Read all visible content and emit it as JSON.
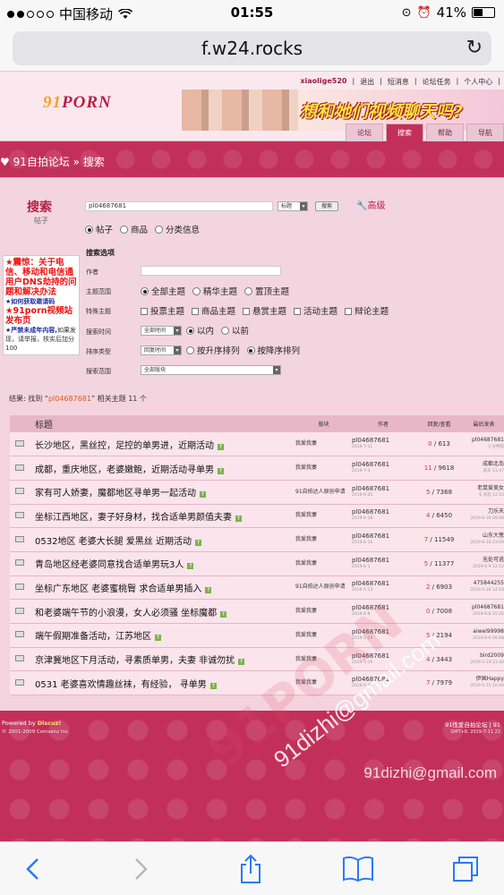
{
  "status_bar": {
    "carrier": "中国移动",
    "time": "01:55",
    "battery": "41%",
    "battery_level": 0.41
  },
  "browser": {
    "url": "f.w24.rocks"
  },
  "site": {
    "top_links": [
      "xiaolige520",
      "退出",
      "短消息",
      "论坛任务",
      "个人中心"
    ],
    "logo_main": "91",
    "logo_accent": "PORN",
    "banner_text": "想和她们视频聊天吗?",
    "nav_tabs": [
      "论坛",
      "搜索",
      "帮助",
      "导航"
    ],
    "breadcrumb": "91自拍论坛 » 搜索"
  },
  "search": {
    "title": "搜索",
    "subtitle": "帖子",
    "keyword": "pl04687681",
    "field_select": "标题",
    "search_button": "搜索",
    "advanced": "高级",
    "types": [
      "帖子",
      "商品",
      "分类信息"
    ],
    "options_heading": "搜索选项",
    "author_label": "作者",
    "scope_label": "主题范围",
    "scope_options": [
      "全部主题",
      "精华主题",
      "置顶主题"
    ],
    "special_label": "特殊主题",
    "special_options": [
      "投票主题",
      "商品主题",
      "悬赏主题",
      "活动主题",
      "辩论主题"
    ],
    "time_label": "搜索时间",
    "time_select": "全部时间",
    "time_options": [
      "以内",
      "以前"
    ],
    "sort_label": "排序类型",
    "sort_select": "回复时间",
    "sort_options": [
      "按升序排列",
      "按降序排列"
    ],
    "range_label": "搜索范围",
    "range_select": "全部版块"
  },
  "side_ad": {
    "line1": "★震惊：关于电信、移动和电信通用户DNS劫持的问题和解决办法",
    "line2": "★如何获取邀请码",
    "line3": "★91porn视频站发布页",
    "line4_bold": "★严禁未成年内容,",
    "line4": "如果发现，请举报，核实后加分100"
  },
  "results": {
    "prefix": "结果: 找到 “",
    "keyword": "pl04687681",
    "suffix": "” 相关主题 11 个",
    "headers": [
      "标题",
      "版块",
      "作者",
      "回复/查看",
      "最后发表"
    ],
    "rows": [
      {
        "title": "长沙地区，黑丝控，足控的单男进，近期活动",
        "board": "我爱我妻",
        "author": "pl04687681",
        "date": "2019-7-11",
        "replies": "0",
        "views": "613",
        "last": "pl04687681",
        "last_date": "3 分钟前"
      },
      {
        "title": "成都，重庆地区，老婆嫩鲍，近期活动寻单男",
        "board": "我爱我妻",
        "author": "pl04687681",
        "date": "2019-7-3",
        "replies": "11",
        "views": "9618",
        "last": "成都北岛",
        "last_date": "前天 11:47"
      },
      {
        "title": "家有可人娇妻，魔都地区寻单男一起活动",
        "board": "91自拍达人原创申请",
        "author": "pl04687681",
        "date": "2019-6-25",
        "replies": "5",
        "views": "7368",
        "last": "老鼠爱美女",
        "last_date": "6 天前 12:10"
      },
      {
        "title": "坐标江西地区，妻子好身材，找合适单男颜值夫妻",
        "board": "我爱我妻",
        "author": "pl04687681",
        "date": "2019-6-18",
        "replies": "4",
        "views": "6450",
        "last": "刀乐天",
        "last_date": "2019-6-30 09:08"
      },
      {
        "title": "0532地区 老婆大长腿 爱黑丝 近期活动",
        "board": "我爱我妻",
        "author": "pl04687681",
        "date": "2019-6-14",
        "replies": "7",
        "views": "11549",
        "last": "山东大葱",
        "last_date": "2019-6-18 23:09"
      },
      {
        "title": "青岛地区经老婆同意找合适单男玩3人",
        "board": "我爱我妻",
        "author": "pl04687681",
        "date": "2019-6-1",
        "replies": "5",
        "views": "11377",
        "last": "无处可逃",
        "last_date": "2019-6-9 12:12"
      },
      {
        "title": "坐标广东地区 老婆蜜桃臀 求合适单男插入",
        "board": "91自拍达人原创申请",
        "author": "pl04687681",
        "date": "2019-5-13",
        "replies": "2",
        "views": "6903",
        "last": "475844255",
        "last_date": "2019-5-28 14:18"
      },
      {
        "title": "和老婆端午节的小浪漫，女人必须骚 坐标魔都",
        "board": "我爱我妻",
        "author": "pl04687681",
        "date": "2019-6-8",
        "replies": "0",
        "views": "7008",
        "last": "pl04687681",
        "last_date": "2019-6-8 15:20"
      },
      {
        "title": "端午假期准备活动，江苏地区",
        "board": "我爱我妻",
        "author": "pl04687681",
        "date": "2019-5-29",
        "replies": "5",
        "views": "2194",
        "last": "aiwei99998",
        "last_date": "2019-6-6 09:08"
      },
      {
        "title": "京津冀地区下月活动，寻素质单男，夫妻 非诚勿扰",
        "board": "我爱我妻",
        "author": "pl04687681",
        "date": "2019-5-19",
        "replies": "4",
        "views": "3443",
        "last": "bird2009",
        "last_date": "2019-5-19 21:40"
      },
      {
        "title": "0531 老婆喜欢情趣丝袜，有经验， 寻单男",
        "board": "我爱我妻",
        "author": "pl04687681",
        "date": "2019-5-11",
        "replies": "7",
        "views": "7979",
        "last": "伊国Happy",
        "last_date": "2019-5-15 16:44"
      }
    ]
  },
  "footer": {
    "powered": "Powered by",
    "powered_brand": "Discuz!",
    "copyright": "© 2001-2009 Comsenz Inc.",
    "right_links": "91性爱自拍论坛 | 91",
    "right_time": "GMT+8, 2019-7-11 22"
  },
  "watermarks": {
    "email_diag": "91dizhi@gmail.com",
    "brand_diag": "91PORN",
    "email_corner": "91dizhi@gmail.com"
  }
}
